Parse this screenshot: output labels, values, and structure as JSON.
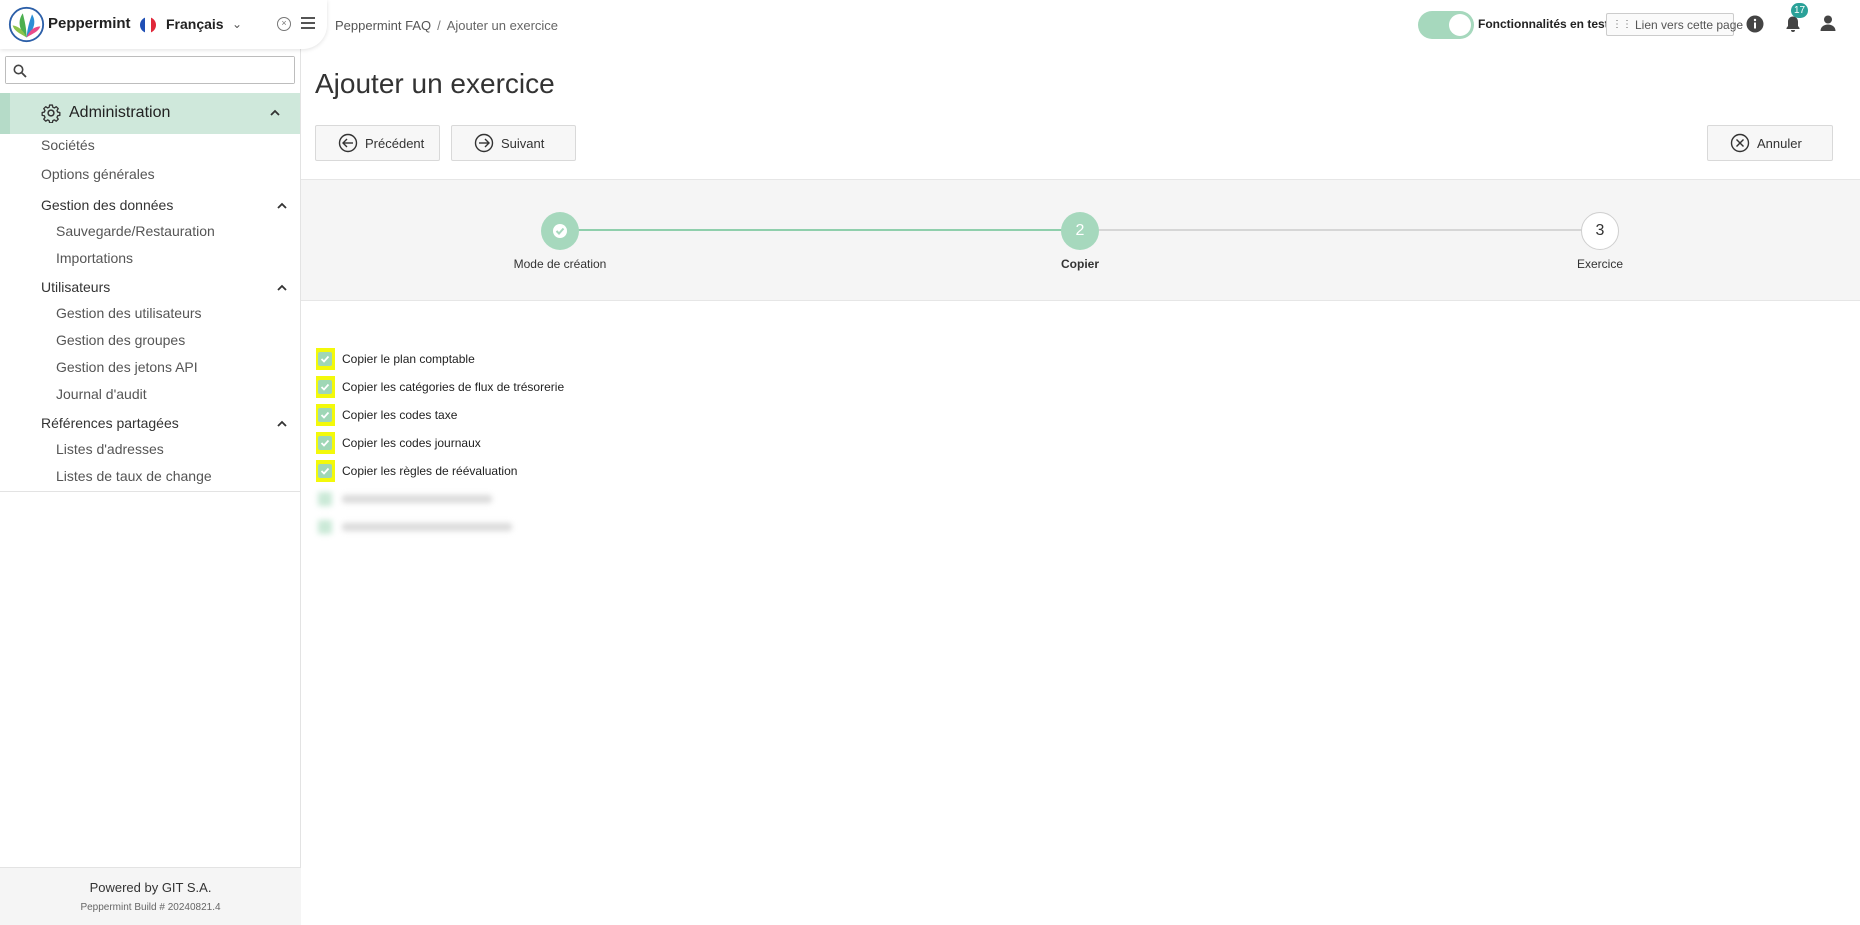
{
  "app": {
    "name": "Peppermint",
    "language": "Français"
  },
  "sidebar": {
    "search_placeholder": "",
    "section": "Administration",
    "items": [
      {
        "label": "Sociétés"
      },
      {
        "label": "Options générales"
      }
    ],
    "groups": [
      {
        "label": "Gestion des données",
        "items": [
          "Sauvegarde/Restauration",
          "Importations"
        ]
      },
      {
        "label": "Utilisateurs",
        "items": [
          "Gestion des utilisateurs",
          "Gestion des groupes",
          "Gestion des jetons API",
          "Journal d'audit"
        ]
      },
      {
        "label": "Références partagées",
        "items": [
          "Listes d'adresses",
          "Listes de taux de change"
        ]
      }
    ],
    "footer": {
      "powered_by": "Powered by GIT S.A.",
      "build": "Peppermint Build # 20240821.4"
    }
  },
  "header": {
    "breadcrumb": [
      "Peppermint FAQ",
      "Ajouter un exercice"
    ],
    "feature_toggle_label": "Fonctionnalités en test",
    "feature_toggle_on": true,
    "link_button": "Lien vers cette page",
    "notification_count": "17"
  },
  "main": {
    "title": "Ajouter un exercice",
    "buttons": {
      "previous": "Précédent",
      "next": "Suivant",
      "cancel": "Annuler"
    },
    "steps": [
      {
        "label": "Mode de création",
        "marker": "✓",
        "state": "done"
      },
      {
        "label": "Copier",
        "marker": "2",
        "state": "active"
      },
      {
        "label": "Exercice",
        "marker": "3",
        "state": "todo"
      }
    ],
    "options": [
      {
        "label": "Copier le plan comptable",
        "checked": true
      },
      {
        "label": "Copier les catégories de flux de trésorerie",
        "checked": true
      },
      {
        "label": "Copier les codes taxe",
        "checked": true
      },
      {
        "label": "Copier les codes journaux",
        "checked": true
      },
      {
        "label": "Copier les règles de réévaluation",
        "checked": true
      }
    ],
    "blurred_option_count": 2
  },
  "colors": {
    "accent": "#a6d8bd",
    "active_menu_bg": "#cfe8db",
    "highlight": "#f3f90a",
    "badge": "#2aa198"
  }
}
